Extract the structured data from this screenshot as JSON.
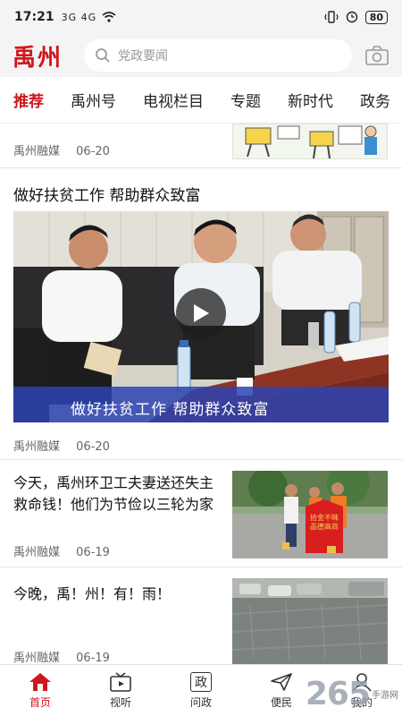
{
  "status_bar": {
    "time": "17:21",
    "signal": "3G 4G",
    "battery": "80"
  },
  "header": {
    "logo": "禹州",
    "search_placeholder": "党政要闻"
  },
  "tabs": [
    {
      "label": "推荐",
      "active": true
    },
    {
      "label": "禹州号"
    },
    {
      "label": "电视栏目"
    },
    {
      "label": "专题"
    },
    {
      "label": "新时代"
    },
    {
      "label": "政务"
    }
  ],
  "feed": [
    {
      "source": "禹州融媒",
      "date": "06-20"
    },
    {
      "title": "做好扶贫工作 帮助群众致富",
      "caption": "做好扶贫工作 帮助群众致富",
      "source": "禹州融媒",
      "date": "06-20",
      "type": "video"
    },
    {
      "title": "今天，禹州环卫工夫妻送还失主救命钱！他们为节俭以三轮为家",
      "source": "禹州融媒",
      "date": "06-19",
      "banner_text": "拾金不昧 品德高尚"
    },
    {
      "title": "今晚，禹！州！有！雨！",
      "source": "禹州融媒",
      "date": "06-19"
    }
  ],
  "bottom_nav": [
    {
      "label": "首页",
      "icon": "home-icon",
      "active": true
    },
    {
      "label": "视听",
      "icon": "tv-icon"
    },
    {
      "label": "问政",
      "icon": "zheng-icon",
      "glyph": "政"
    },
    {
      "label": "便民",
      "icon": "send-icon"
    },
    {
      "label": "我的",
      "icon": "user-icon"
    }
  ],
  "watermark": {
    "brand": "265",
    "sub": "手游网"
  },
  "colors": {
    "accent": "#d0161c"
  }
}
